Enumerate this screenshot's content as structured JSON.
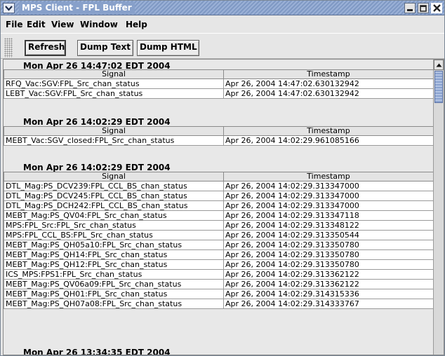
{
  "window": {
    "title": "MPS Client - FPL Buffer"
  },
  "menu": [
    "File",
    "Edit",
    "View",
    "Window",
    "Help"
  ],
  "toolbar": {
    "refresh_label": "Refresh",
    "dump_text_label": "Dump Text",
    "dump_html_label": "Dump HTML"
  },
  "columns": {
    "signal": "Signal",
    "timestamp": "Timestamp"
  },
  "sections": [
    {
      "title": "Mon Apr 26 14:47:02 EDT 2004",
      "rows": [
        [
          "RFQ_Vac:SGV:FPL_Src_chan_status",
          "Apr 26, 2004 14:47:02.630132942"
        ],
        [
          "LEBT_Vac:SGV:FPL_Src_chan_status",
          "Apr 26, 2004 14:47:02.630132942"
        ]
      ]
    },
    {
      "title": "Mon Apr 26 14:02:29 EDT 2004",
      "rows": [
        [
          "MEBT_Vac:SGV_closed:FPL_Src_chan_status",
          "Apr 26, 2004 14:02:29.961085166"
        ]
      ]
    },
    {
      "title": "Mon Apr 26 14:02:29 EDT 2004",
      "rows": [
        [
          "DTL_Mag:PS_DCV239:FPL_CCL_BS_chan_status",
          "Apr 26, 2004 14:02:29.313347000"
        ],
        [
          "DTL_Mag:PS_DCV245:FPL_CCL_BS_chan_status",
          "Apr 26, 2004 14:02:29.313347000"
        ],
        [
          "DTL_Mag:PS_DCH242:FPL_CCL_BS_chan_status",
          "Apr 26, 2004 14:02:29.313347000"
        ],
        [
          "MEBT_Mag:PS_QV04:FPL_Src_chan_status",
          "Apr 26, 2004 14:02:29.313347118"
        ],
        [
          "MPS:FPL_Src:FPL_Src_chan_status",
          "Apr 26, 2004 14:02:29.313348122"
        ],
        [
          "MPS:FPL_CCL_BS:FPL_Src_chan_status",
          "Apr 26, 2004 14:02:29.313350544"
        ],
        [
          "MEBT_Mag:PS_QH05a10:FPL_Src_chan_status",
          "Apr 26, 2004 14:02:29.313350780"
        ],
        [
          "MEBT_Mag:PS_QH14:FPL_Src_chan_status",
          "Apr 26, 2004 14:02:29.313350780"
        ],
        [
          "MEBT_Mag:PS_QH12:FPL_Src_chan_status",
          "Apr 26, 2004 14:02:29.313350780"
        ],
        [
          "ICS_MPS:FPS1:FPL_Src_chan_status",
          "Apr 26, 2004 14:02:29.313362122"
        ],
        [
          "MEBT_Mag:PS_QV06a09:FPL_Src_chan_status",
          "Apr 26, 2004 14:02:29.313362122"
        ],
        [
          "MEBT_Mag:PS_QH01:FPL_Src_chan_status",
          "Apr 26, 2004 14:02:29.314315336"
        ],
        [
          "MEBT_Mag:PS_QH07a08:FPL_Src_chan_status",
          "Apr 26, 2004 14:02:29.314333767"
        ]
      ]
    },
    {
      "title": "Mon Apr 26 13:34:35 EDT 2004",
      "rows": []
    }
  ]
}
